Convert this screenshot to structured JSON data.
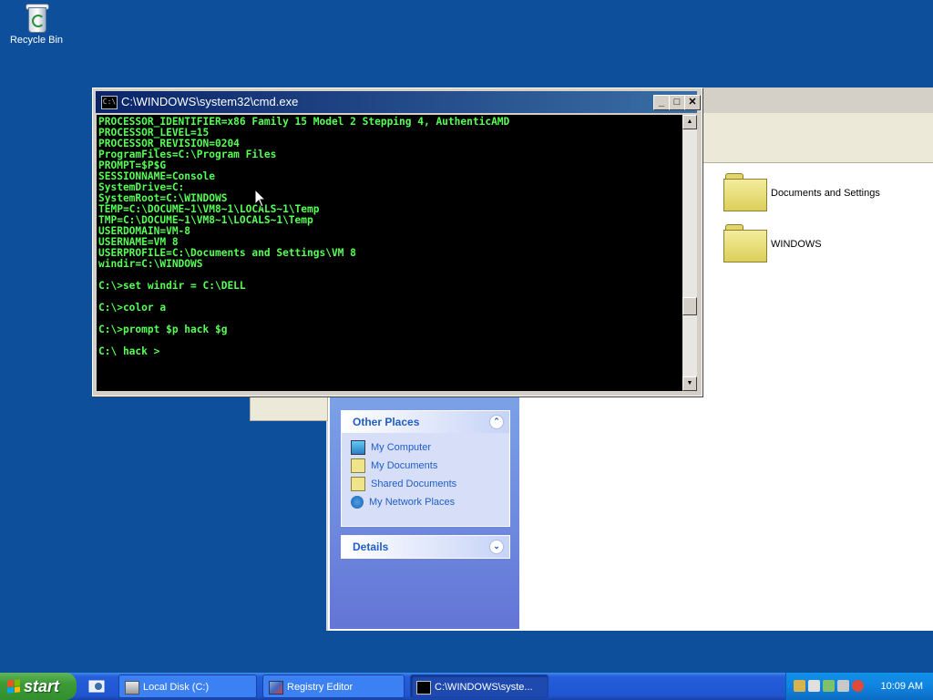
{
  "desktop": {
    "recycle_bin_label": "Recycle Bin"
  },
  "explorer": {
    "folders": [
      {
        "name": "Documents and Settings"
      },
      {
        "name": "WINDOWS"
      }
    ],
    "other_places": {
      "title": "Other Places",
      "items": [
        {
          "label": "My Computer",
          "icon": "my-computer-icon"
        },
        {
          "label": "My Documents",
          "icon": "my-documents-icon"
        },
        {
          "label": "Shared Documents",
          "icon": "shared-documents-icon"
        },
        {
          "label": "My Network Places",
          "icon": "network-places-icon"
        }
      ]
    },
    "details": {
      "title": "Details"
    }
  },
  "cmd": {
    "title": "C:\\WINDOWS\\system32\\cmd.exe",
    "icon_text": "C:\\",
    "text_color": "#55ff55",
    "lines": [
      "PROCESSOR_IDENTIFIER=x86 Family 15 Model 2 Stepping 4, AuthenticAMD",
      "PROCESSOR_LEVEL=15",
      "PROCESSOR_REVISION=0204",
      "ProgramFiles=C:\\Program Files",
      "PROMPT=$P$G",
      "SESSIONNAME=Console",
      "SystemDrive=C:",
      "SystemRoot=C:\\WINDOWS",
      "TEMP=C:\\DOCUME~1\\VM8~1\\LOCALS~1\\Temp",
      "TMP=C:\\DOCUME~1\\VM8~1\\LOCALS~1\\Temp",
      "USERDOMAIN=VM-8",
      "USERNAME=VM 8",
      "USERPROFILE=C:\\Documents and Settings\\VM 8",
      "windir=C:\\WINDOWS",
      "",
      "C:\\>set windir = C:\\DELL",
      "",
      "C:\\>color a",
      "",
      "C:\\>prompt $p hack $g",
      "",
      "C:\\ hack >"
    ]
  },
  "taskbar": {
    "start_label": "start",
    "buttons": [
      {
        "label": "Local Disk (C:)",
        "icon": "drive-icon",
        "active": false
      },
      {
        "label": "Registry Editor",
        "icon": "registry-icon",
        "active": false
      },
      {
        "label": "C:\\WINDOWS\\syste...",
        "icon": "cmd-icon",
        "active": true
      }
    ],
    "clock": "10:09 AM"
  }
}
